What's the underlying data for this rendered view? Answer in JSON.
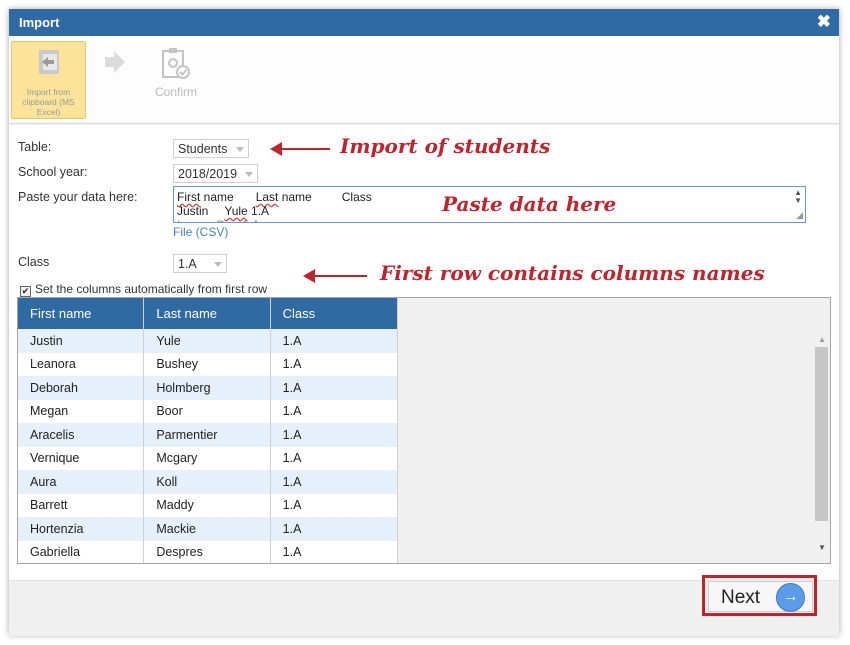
{
  "dialog": {
    "title": "Import",
    "close_label": "✖"
  },
  "toolbar": {
    "import_label": "Import from clipboard (MS Excel)",
    "confirm_label": "Confirm"
  },
  "form": {
    "table_label": "Table:",
    "table_value": "Students",
    "school_year_label": "School year:",
    "school_year_value": "2018/2019",
    "paste_label": "Paste your data here:",
    "paste_lines": [
      [
        "First",
        " name",
        "Last",
        " name",
        "Class"
      ],
      [
        "Justin",
        "Yule",
        " 1.A"
      ]
    ],
    "file_link": "File (CSV)",
    "class_label": "Class",
    "class_value": "1.A",
    "auto_columns_label": "Set the columns automatically from first row",
    "auto_columns_checked": true
  },
  "grid": {
    "columns": [
      "First name",
      "Last name",
      "Class"
    ],
    "rows": [
      [
        "Justin",
        "Yule",
        "1.A"
      ],
      [
        "Leanora",
        "Bushey",
        "1.A"
      ],
      [
        "Deborah",
        "Holmberg",
        "1.A"
      ],
      [
        "Megan",
        "Boor",
        "1.A"
      ],
      [
        "Aracelis",
        "Parmentier",
        "1.A"
      ],
      [
        "Vernique",
        "Mcgary",
        "1.A"
      ],
      [
        "Aura",
        "Koll",
        "1.A"
      ],
      [
        "Barrett",
        "Maddy",
        "1.A"
      ],
      [
        "Hortenzia",
        "Mackie",
        "1.A"
      ],
      [
        "Gabriella",
        "Despres",
        "1.A"
      ]
    ]
  },
  "footer": {
    "next_label": "Next"
  },
  "annotations": {
    "students": "Import of students",
    "paste": "Paste data here",
    "first_row": "First row contains columns names"
  },
  "colors": {
    "header_blue": "#2f6aa3",
    "highlight_red": "#c0232c",
    "row_alt": "#e6f0fa"
  }
}
